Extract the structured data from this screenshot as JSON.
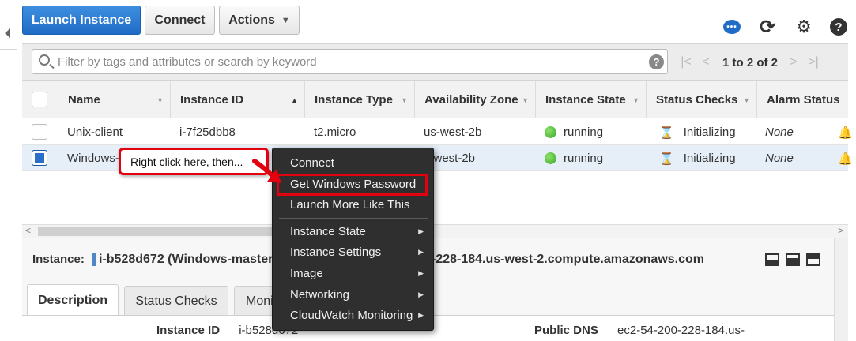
{
  "toolbar": {
    "launch_label": "Launch Instance",
    "connect_label": "Connect",
    "actions_label": "Actions",
    "actions_caret": "▼"
  },
  "icons": {
    "chat": "speech-bubble-icon",
    "refresh": "refresh-icon",
    "settings": "gear-icon",
    "help": "question-icon"
  },
  "filter": {
    "placeholder": "Filter by tags and attributes or search by keyword",
    "help_glyph": "?"
  },
  "pagination": {
    "first": "|<",
    "prev": "<",
    "label": "1 to 2 of 2",
    "next": ">",
    "last": ">|"
  },
  "table": {
    "columns": [
      "Name",
      "Instance ID",
      "Instance Type",
      "Availability Zone",
      "Instance State",
      "Status Checks",
      "Alarm Status"
    ],
    "rows": [
      {
        "name": "Unix-client",
        "id": "i-7f25dbb8",
        "type": "t2.micro",
        "zone": "us-west-2b",
        "state": "running",
        "checks": "Initializing",
        "alarm": "None",
        "selected": false
      },
      {
        "name": "Windows-",
        "id": "",
        "type": "",
        "zone": "s-west-2b",
        "state": "running",
        "checks": "Initializing",
        "alarm": "None",
        "selected": true
      }
    ]
  },
  "callout": {
    "text": "Right click here, then...",
    "border_color": "#e3000f"
  },
  "context_menu": {
    "items": [
      {
        "label": "Connect",
        "submenu": false
      },
      {
        "label": "Get Windows Password",
        "submenu": false,
        "highlighted": true
      },
      {
        "label": "Launch More Like This",
        "submenu": false
      },
      {
        "label": "Instance State",
        "submenu": true
      },
      {
        "label": "Instance Settings",
        "submenu": true
      },
      {
        "label": "Image",
        "submenu": true
      },
      {
        "label": "Networking",
        "submenu": true
      },
      {
        "label": "CloudWatch Monitoring",
        "submenu": true
      }
    ],
    "submenu_glyph": "▶"
  },
  "details": {
    "instance_label": "Instance:",
    "instance_value": "i-b528d672 (Windows-master",
    "dns_suffix": "-228-184.us-west-2.compute.amazonaws.com",
    "tabs": [
      "Description",
      "Status Checks",
      "Moni"
    ],
    "fields": {
      "instance_id_label": "Instance ID",
      "instance_id_value": "i-b528d672",
      "public_dns_label": "Public DNS",
      "public_dns_value": "ec2-54-200-228-184.us-"
    }
  },
  "colors": {
    "primary": "#1f6cc6",
    "running": "#3aa52a",
    "annotation": "#e3000f",
    "menu_bg": "#2f2f2f"
  }
}
